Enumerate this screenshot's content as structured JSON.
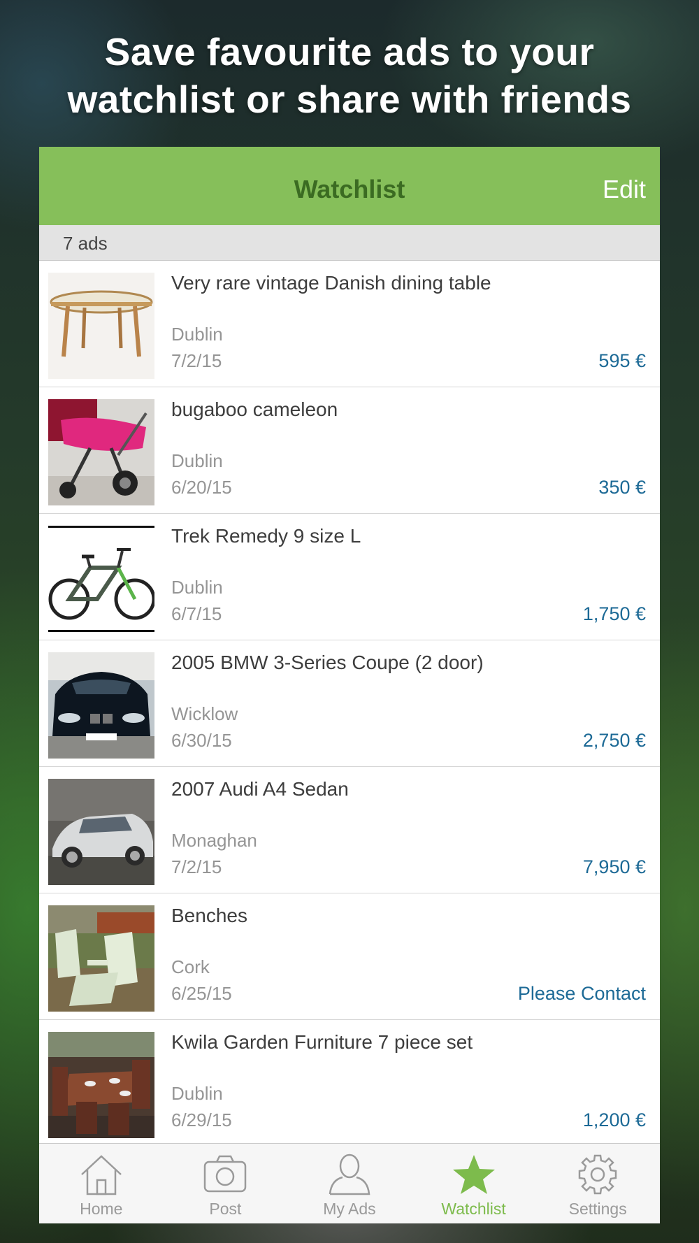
{
  "headline": {
    "line1": "Save favourite ads to your",
    "line2": "watchlist or share with friends"
  },
  "navbar": {
    "title": "Watchlist",
    "edit_label": "Edit"
  },
  "section": {
    "count_label": "7 ads"
  },
  "ads": [
    {
      "title": "Very rare vintage Danish dining table",
      "location": "Dublin",
      "date": "7/2/15",
      "price": "595 €",
      "thumb": "dining-table-photo"
    },
    {
      "title": "bugaboo cameleon",
      "location": "Dublin",
      "date": "6/20/15",
      "price": "350 €",
      "thumb": "pram-photo"
    },
    {
      "title": "Trek Remedy 9 size L",
      "location": "Dublin",
      "date": "6/7/15",
      "price": "1,750 €",
      "thumb": "mountain-bike-photo"
    },
    {
      "title": "2005 BMW 3-Series Coupe (2 door)",
      "location": "Wicklow",
      "date": "6/30/15",
      "price": "2,750 €",
      "thumb": "bmw-car-photo"
    },
    {
      "title": "2007 Audi A4 Sedan",
      "location": "Monaghan",
      "date": "7/2/15",
      "price": "7,950 €",
      "thumb": "audi-car-photo"
    },
    {
      "title": "Benches",
      "location": "Cork",
      "date": "6/25/15",
      "price": "Please Contact",
      "thumb": "garden-benches-photo"
    },
    {
      "title": "Kwila Garden Furniture 7 piece set",
      "location": "Dublin",
      "date": "6/29/15",
      "price": "1,200 €",
      "thumb": "garden-furniture-photo"
    }
  ],
  "tabbar": {
    "tabs": [
      {
        "label": "Home",
        "icon": "home-icon"
      },
      {
        "label": "Post",
        "icon": "camera-icon"
      },
      {
        "label": "My Ads",
        "icon": "person-icon"
      },
      {
        "label": "Watchlist",
        "icon": "star-icon",
        "active": true
      },
      {
        "label": "Settings",
        "icon": "gear-icon"
      }
    ],
    "active_color": "#7dbb4c",
    "inactive_color": "#9a9a9a"
  },
  "colors": {
    "nav_green": "#86bf5a",
    "price_blue": "#1d6a96"
  }
}
